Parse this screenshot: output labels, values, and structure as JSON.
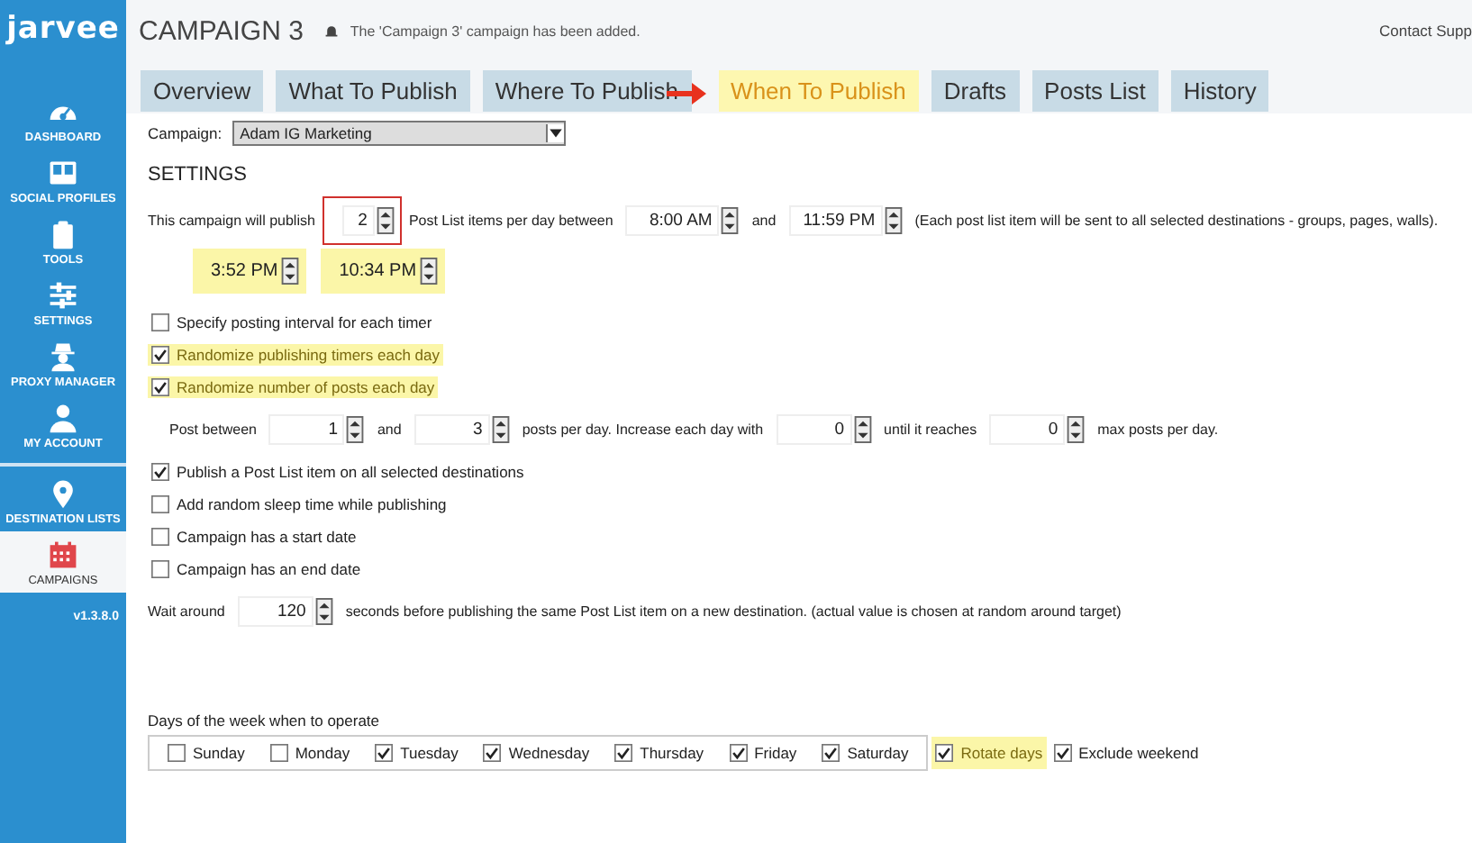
{
  "header": {
    "title": "CAMPAIGN 3",
    "notice": "The 'Campaign 3' campaign has been added.",
    "contact": "Contact Supp"
  },
  "sidebar": {
    "logo": "jarvee",
    "version": "v1.3.8.0",
    "items": [
      {
        "label": "DASHBOARD",
        "selected": false
      },
      {
        "label": "SOCIAL PROFILES",
        "selected": false
      },
      {
        "label": "TOOLS",
        "selected": false
      },
      {
        "label": "SETTINGS",
        "selected": false
      },
      {
        "label": "PROXY MANAGER",
        "selected": false
      },
      {
        "label": "MY ACCOUNT",
        "selected": false
      },
      {
        "label": "DESTINATION LISTS",
        "selected": false
      },
      {
        "label": "CAMPAIGNS",
        "selected": true
      }
    ]
  },
  "tabs": [
    {
      "label": "Overview",
      "selected": false,
      "highlighted": false,
      "arrow": false
    },
    {
      "label": "What To Publish",
      "selected": false,
      "highlighted": false,
      "arrow": false
    },
    {
      "label": "Where To Publish",
      "selected": false,
      "highlighted": false,
      "arrow": false
    },
    {
      "label": "When To Publish",
      "selected": true,
      "highlighted": true,
      "arrow": true
    },
    {
      "label": "Drafts",
      "selected": false,
      "highlighted": false,
      "arrow": false
    },
    {
      "label": "Posts List",
      "selected": false,
      "highlighted": false,
      "arrow": false
    },
    {
      "label": "History",
      "selected": false,
      "highlighted": false,
      "arrow": false
    }
  ],
  "campaign": {
    "label": "Campaign:",
    "value": "Adam IG Marketing"
  },
  "settings": {
    "heading": "SETTINGS",
    "publish": [
      {
        "kind": "text",
        "text": "This campaign will publish"
      },
      {
        "kind": "spinner",
        "value": "2",
        "outlined": true
      },
      {
        "kind": "text",
        "text": "Post List items per day between"
      },
      {
        "kind": "spinner",
        "value": "8:00 AM"
      },
      {
        "kind": "text",
        "text": "and"
      },
      {
        "kind": "spinner",
        "value": "11:59 PM"
      },
      {
        "kind": "text",
        "text": "(Each post list item will be sent to all selected destinations - groups, pages, walls)."
      }
    ],
    "timers": [
      {
        "value": "3:52 PM",
        "highlighted": true
      },
      {
        "value": "10:34 PM",
        "highlighted": true
      }
    ],
    "options": [
      {
        "kind": "checkbox",
        "label": "Specify posting interval for each timer",
        "checked": false,
        "highlighted": false
      },
      {
        "kind": "checkbox",
        "label": "Randomize publishing timers each day",
        "checked": true,
        "highlighted": true
      },
      {
        "kind": "checkbox",
        "label": "Randomize number of posts each day",
        "checked": true,
        "highlighted": true
      },
      {
        "kind": "inputs",
        "parts": [
          {
            "kind": "text",
            "text": "Post between"
          },
          {
            "kind": "spinner",
            "value": "1"
          },
          {
            "kind": "text",
            "text": "and"
          },
          {
            "kind": "spinner",
            "value": "3"
          },
          {
            "kind": "text",
            "text": "posts per day.  Increase each day with"
          },
          {
            "kind": "spinner",
            "value": "0"
          },
          {
            "kind": "text",
            "text": "until it reaches"
          },
          {
            "kind": "spinner",
            "value": "0"
          },
          {
            "kind": "text",
            "text": "max posts per day."
          }
        ]
      },
      {
        "kind": "checkbox",
        "label": "Publish a Post List item on all selected destinations",
        "checked": true,
        "highlighted": false
      },
      {
        "kind": "checkbox",
        "label": "Add random sleep time while publishing",
        "checked": false,
        "highlighted": false
      },
      {
        "kind": "checkbox",
        "label": "Campaign has a start date",
        "checked": false,
        "highlighted": false
      },
      {
        "kind": "checkbox",
        "label": "Campaign has an end date",
        "checked": false,
        "highlighted": false
      },
      {
        "kind": "inputs",
        "parts": [
          {
            "kind": "text",
            "text": "Wait around"
          },
          {
            "kind": "spinner",
            "value": "120"
          },
          {
            "kind": "text",
            "text": "seconds before publishing the same Post List item on a new destination. (actual value is chosen at random around target)"
          }
        ]
      }
    ]
  },
  "days": {
    "label": "Days of the week when to operate",
    "items": [
      {
        "label": "Sunday",
        "checked": false
      },
      {
        "label": "Monday",
        "checked": false
      },
      {
        "label": "Tuesday",
        "checked": true
      },
      {
        "label": "Wednesday",
        "checked": true
      },
      {
        "label": "Thursday",
        "checked": true
      },
      {
        "label": "Friday",
        "checked": true
      },
      {
        "label": "Saturday",
        "checked": true
      }
    ],
    "extras": [
      {
        "label": "Rotate days",
        "checked": true,
        "highlighted": true
      },
      {
        "label": "Exclude weekend",
        "checked": true,
        "highlighted": false
      }
    ]
  }
}
